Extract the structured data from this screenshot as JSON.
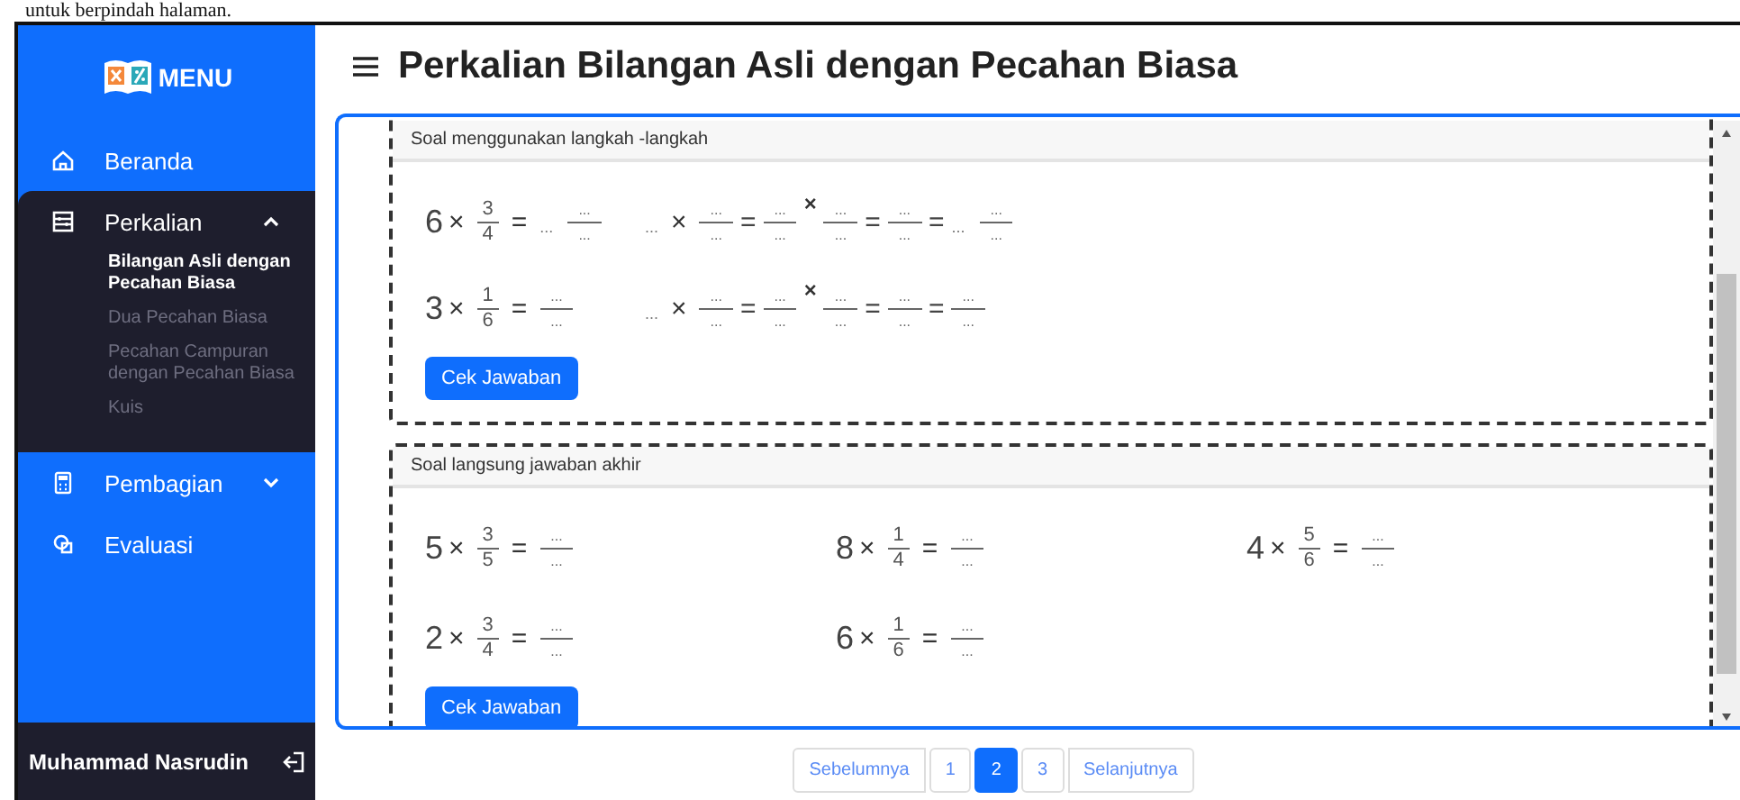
{
  "document_caption": "untuk berpindah halaman.",
  "sidebar": {
    "logo_text": "MENU",
    "items": [
      {
        "label": "Beranda",
        "kind": "link"
      },
      {
        "label": "Perkalian",
        "kind": "group",
        "expanded": true,
        "children": [
          {
            "label": "Bilangan Asli dengan Pecahan Biasa",
            "selected": true
          },
          {
            "label": "Dua Pecahan Biasa",
            "selected": false
          },
          {
            "label": "Pecahan Campuran dengan Pecahan Biasa",
            "selected": false
          },
          {
            "label": "Kuis",
            "selected": false
          }
        ]
      },
      {
        "label": "Pembagian",
        "kind": "group",
        "expanded": false
      },
      {
        "label": "Evaluasi",
        "kind": "link"
      }
    ]
  },
  "user": {
    "name": "Muhammad Nasrudin"
  },
  "header": {
    "title": "Perkalian Bilangan Asli dengan Pecahan Biasa"
  },
  "sections": [
    {
      "title": "Soal menggunakan langkah -langkah",
      "kind": "steps",
      "button": "Cek Jawaban",
      "problems": [
        {
          "expression": [
            {
              "kind": "num",
              "text": "6"
            },
            {
              "kind": "op",
              "text": "×"
            },
            {
              "kind": "frac",
              "num": "3",
              "den": "4"
            },
            {
              "kind": "op",
              "text": "="
            },
            {
              "kind": "blank",
              "text": "..."
            },
            {
              "kind": "frac",
              "num": "...",
              "den": "..."
            }
          ],
          "steps": [
            {
              "kind": "blank",
              "text": "..."
            },
            {
              "kind": "op",
              "text": "×"
            },
            {
              "kind": "frac",
              "num": "...",
              "den": "..."
            },
            {
              "kind": "eq",
              "text": "="
            },
            {
              "kind": "frac",
              "num": "...",
              "den": "..."
            },
            {
              "kind": "sup",
              "text": "×"
            },
            {
              "kind": "frac",
              "num": "...",
              "den": "..."
            },
            {
              "kind": "eq",
              "text": "="
            },
            {
              "kind": "frac",
              "num": "...",
              "den": "..."
            },
            {
              "kind": "eq",
              "text": "="
            },
            {
              "kind": "blank",
              "text": "..."
            },
            {
              "kind": "frac",
              "num": "...",
              "den": "..."
            }
          ]
        },
        {
          "expression": [
            {
              "kind": "num",
              "text": "3"
            },
            {
              "kind": "op",
              "text": "×"
            },
            {
              "kind": "frac",
              "num": "1",
              "den": "6"
            },
            {
              "kind": "op",
              "text": "="
            },
            {
              "kind": "frac",
              "num": "...",
              "den": "..."
            }
          ],
          "steps": [
            {
              "kind": "blank",
              "text": "..."
            },
            {
              "kind": "op",
              "text": "×"
            },
            {
              "kind": "frac",
              "num": "...",
              "den": "..."
            },
            {
              "kind": "eq",
              "text": "="
            },
            {
              "kind": "frac",
              "num": "...",
              "den": "..."
            },
            {
              "kind": "sup",
              "text": "×"
            },
            {
              "kind": "frac",
              "num": "...",
              "den": "..."
            },
            {
              "kind": "eq",
              "text": "="
            },
            {
              "kind": "frac",
              "num": "...",
              "den": "..."
            },
            {
              "kind": "eq",
              "text": "="
            },
            {
              "kind": "frac",
              "num": "...",
              "den": "..."
            }
          ]
        }
      ]
    },
    {
      "title": "Soal langsung jawaban akhir",
      "kind": "grid",
      "button": "Cek Jawaban",
      "problems": [
        {
          "expression": [
            {
              "kind": "num",
              "text": "5"
            },
            {
              "kind": "op",
              "text": "×"
            },
            {
              "kind": "frac",
              "num": "3",
              "den": "5"
            },
            {
              "kind": "op",
              "text": "="
            },
            {
              "kind": "frac",
              "num": "...",
              "den": "..."
            }
          ]
        },
        {
          "expression": [
            {
              "kind": "num",
              "text": "8"
            },
            {
              "kind": "op",
              "text": "×"
            },
            {
              "kind": "frac",
              "num": "1",
              "den": "4"
            },
            {
              "kind": "op",
              "text": "="
            },
            {
              "kind": "frac",
              "num": "...",
              "den": "..."
            }
          ]
        },
        {
          "expression": [
            {
              "kind": "num",
              "text": "4"
            },
            {
              "kind": "op",
              "text": "×"
            },
            {
              "kind": "frac",
              "num": "5",
              "den": "6"
            },
            {
              "kind": "op",
              "text": "="
            },
            {
              "kind": "frac",
              "num": "...",
              "den": "..."
            }
          ]
        },
        {
          "expression": [
            {
              "kind": "num",
              "text": "2"
            },
            {
              "kind": "op",
              "text": "×"
            },
            {
              "kind": "frac",
              "num": "3",
              "den": "4"
            },
            {
              "kind": "op",
              "text": "="
            },
            {
              "kind": "frac",
              "num": "...",
              "den": "..."
            }
          ]
        },
        {
          "expression": [
            {
              "kind": "num",
              "text": "6"
            },
            {
              "kind": "op",
              "text": "×"
            },
            {
              "kind": "frac",
              "num": "1",
              "den": "6"
            },
            {
              "kind": "op",
              "text": "="
            },
            {
              "kind": "frac",
              "num": "...",
              "den": "..."
            }
          ]
        }
      ]
    }
  ],
  "pagination": [
    {
      "label": "Sebelumnya",
      "selected": false
    },
    {
      "label": "1",
      "selected": false
    },
    {
      "label": "2",
      "selected": true
    },
    {
      "label": "3",
      "selected": false
    },
    {
      "label": "Selanjutnya",
      "selected": false
    }
  ]
}
